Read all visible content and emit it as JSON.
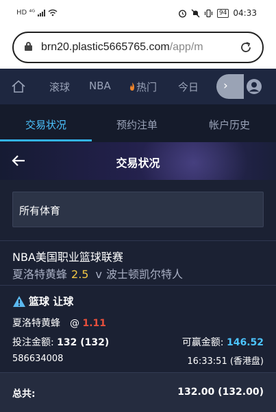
{
  "status_bar": {
    "left_text": "HD ⁴ᴳ",
    "battery": "94",
    "time": "04:33"
  },
  "browser": {
    "url_host": "brn20.plastic5665765.com",
    "url_path": "/app/m"
  },
  "nav": {
    "items": [
      "滚球",
      "NBA",
      "热门",
      "今日"
    ],
    "arrow": "›"
  },
  "subtabs": {
    "items": [
      "交易状况",
      "预约注单",
      "帐户历史"
    ],
    "active_index": 0
  },
  "header": {
    "title": "交易状况"
  },
  "filter": {
    "value": "所有体育"
  },
  "bet": {
    "league": "NBA美国职业篮球联赛",
    "home_team": "夏洛特黄蜂",
    "line": "2.5",
    "vs": "v",
    "away_team": "波士顿凯尔特人",
    "bet_type": "篮球 让球",
    "selection": "夏洛特黄蜂",
    "at": "@",
    "odds": "1.11",
    "stake_label": "投注金额:",
    "stake_value": "132 (132)",
    "win_label": "可赢金额:",
    "win_value": "146.52",
    "ticket_id": "586634008",
    "time": "16:33:51 (香港盘)"
  },
  "total": {
    "label": "总共:",
    "value": "132.00 (132.00)"
  },
  "colors": {
    "accent": "#4cc4ff",
    "odds": "#e8503c",
    "line": "#f2c744",
    "background": "#1b2133"
  }
}
